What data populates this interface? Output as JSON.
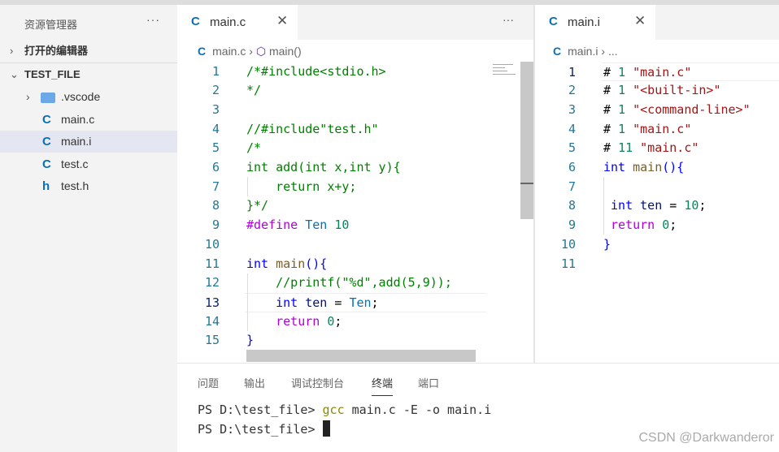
{
  "sidebar": {
    "title": "资源管理器",
    "more": "···",
    "open_editors": "打开的编辑器",
    "folder": "TEST_FILE",
    "items": [
      {
        "icon": "folder",
        "label": ".vscode",
        "expandable": true
      },
      {
        "icon": "C",
        "label": "main.c"
      },
      {
        "icon": "C",
        "label": "main.i",
        "selected": true
      },
      {
        "icon": "C",
        "label": "test.c"
      },
      {
        "icon": "h",
        "label": "test.h"
      }
    ]
  },
  "left_editor": {
    "tab": "main.c",
    "tab_icon": "C",
    "more": "···",
    "breadcrumb": {
      "file": "main.c",
      "symbol": "main()"
    },
    "current_line": 13,
    "lines": [
      [
        [
          "/*#include<stdio.h>",
          "cm"
        ]
      ],
      [
        [
          "*/",
          "cm"
        ]
      ],
      [],
      [
        [
          "//#include\"test.h\"",
          "cm"
        ]
      ],
      [
        [
          "/*",
          "cm"
        ]
      ],
      [
        [
          "int add(int x,int y){",
          "cm"
        ]
      ],
      [
        [
          "    return x+y;",
          "cm"
        ]
      ],
      [
        [
          "}*/",
          "cm"
        ]
      ],
      [
        [
          "#define",
          "pp"
        ],
        [
          " ",
          "plain"
        ],
        [
          "Ten",
          "mac"
        ],
        [
          " ",
          "plain"
        ],
        [
          "10",
          "num"
        ]
      ],
      [],
      [
        [
          "int",
          "kw"
        ],
        [
          " ",
          "plain"
        ],
        [
          "main",
          "fn"
        ],
        [
          "(){",
          "kw"
        ]
      ],
      [
        [
          "    //printf(\"%d\",add(5,9));",
          "cm"
        ]
      ],
      [
        [
          "    ",
          "plain"
        ],
        [
          "int",
          "kw"
        ],
        [
          " ",
          "plain"
        ],
        [
          "ten",
          "var"
        ],
        [
          " = ",
          "plain"
        ],
        [
          "Ten",
          "mac"
        ],
        [
          ";",
          "plain"
        ]
      ],
      [
        [
          "    ",
          "plain"
        ],
        [
          "return",
          "ctl"
        ],
        [
          " ",
          "plain"
        ],
        [
          "0",
          "num"
        ],
        [
          ";",
          "plain"
        ]
      ],
      [
        [
          "}",
          "kw"
        ]
      ]
    ]
  },
  "right_editor": {
    "tab": "main.i",
    "tab_icon": "C",
    "breadcrumb": {
      "file": "main.i",
      "rest": "..."
    },
    "lines": [
      [
        [
          "# ",
          "plain"
        ],
        [
          "1",
          "num"
        ],
        [
          " ",
          "plain"
        ],
        [
          "\"main.c\"",
          "str"
        ]
      ],
      [
        [
          "# ",
          "plain"
        ],
        [
          "1",
          "num"
        ],
        [
          " ",
          "plain"
        ],
        [
          "\"<built-in>\"",
          "str"
        ]
      ],
      [
        [
          "# ",
          "plain"
        ],
        [
          "1",
          "num"
        ],
        [
          " ",
          "plain"
        ],
        [
          "\"<command-line>\"",
          "str"
        ]
      ],
      [
        [
          "# ",
          "plain"
        ],
        [
          "1",
          "num"
        ],
        [
          " ",
          "plain"
        ],
        [
          "\"main.c\"",
          "str"
        ]
      ],
      [
        [
          "# ",
          "plain"
        ],
        [
          "11",
          "num"
        ],
        [
          " ",
          "plain"
        ],
        [
          "\"main.c\"",
          "str"
        ]
      ],
      [
        [
          "int",
          "kw"
        ],
        [
          " ",
          "plain"
        ],
        [
          "main",
          "fn"
        ],
        [
          "(){",
          "kw"
        ]
      ],
      [],
      [
        [
          " ",
          "plain"
        ],
        [
          "int",
          "kw"
        ],
        [
          " ",
          "plain"
        ],
        [
          "ten",
          "var"
        ],
        [
          " = ",
          "plain"
        ],
        [
          "10",
          "num"
        ],
        [
          ";",
          "plain"
        ]
      ],
      [
        [
          " ",
          "plain"
        ],
        [
          "return",
          "ctl"
        ],
        [
          " ",
          "plain"
        ],
        [
          "0",
          "num"
        ],
        [
          ";",
          "plain"
        ]
      ],
      [
        [
          "}",
          "kw"
        ]
      ],
      []
    ]
  },
  "panel": {
    "tabs": [
      "问题",
      "输出",
      "调试控制台",
      "终端",
      "端口"
    ],
    "active": 3,
    "terminal": {
      "prompt": "PS D:\\test_file> ",
      "cmd": "gcc",
      "args": " main.c -E -o main.i"
    }
  },
  "watermark": "CSDN @Darkwanderor"
}
